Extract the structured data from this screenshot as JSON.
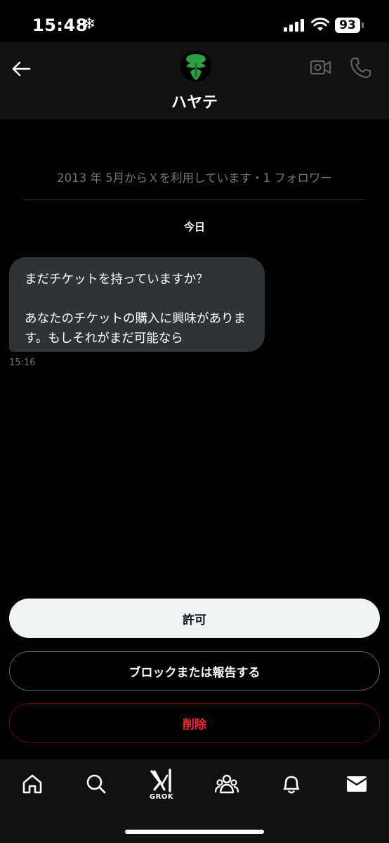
{
  "status_bar": {
    "time": "15:48",
    "snow_glyph": "❄",
    "battery": "93"
  },
  "header": {
    "contact_name": "ハヤテ",
    "avatar_color": "#2ea043"
  },
  "conversation": {
    "joined_info": "2013 年 5月からＸを利用しています・1 フォロワー",
    "date_label": "今日",
    "messages": [
      {
        "text": "まだチケットを持っていますか？\n\nあなたのチケットの購入に興味があります。もしそれがまだ可能なら",
        "time": "15:16"
      }
    ]
  },
  "actions": {
    "allow": "許可",
    "block_report": "ブロックまたは報告する",
    "delete": "削除"
  },
  "nav": {
    "items": [
      "home-icon",
      "search-icon",
      "grok-icon",
      "communities-icon",
      "notifications-icon",
      "messages-icon"
    ],
    "grok_label": "GROK"
  },
  "colors": {
    "accent_danger": "#f4212e",
    "bubble": "#2f3336",
    "muted_text": "#71767b"
  }
}
